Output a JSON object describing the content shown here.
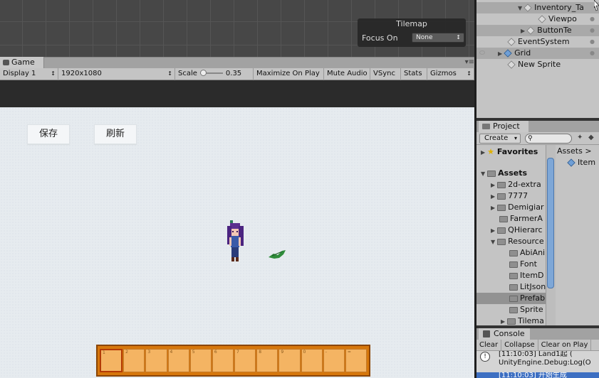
{
  "tilemap": {
    "title": "Tilemap",
    "focus_label": "Focus On",
    "focus_value": "None"
  },
  "game": {
    "tab_label": "Game",
    "menu_glyph": "▾≡",
    "display": "Display 1",
    "resolution": "1920x1080",
    "scale_label": "Scale",
    "scale_value": "0.35",
    "maximize": "Maximize On Play",
    "mute": "Mute Audio",
    "vsync": "VSync",
    "stats": "Stats",
    "gizmos": "Gizmos"
  },
  "ui": {
    "save_button": "保存",
    "refresh_button": "刷新"
  },
  "hotbar": {
    "slots": [
      "1",
      "2",
      "3",
      "4",
      "5",
      "6",
      "7",
      "8",
      "9",
      "0",
      "-",
      "="
    ],
    "selected_index": 0
  },
  "hierarchy": {
    "items": [
      "Inventory_Ta",
      "Viewpo",
      "ButtonTe",
      "EventSystem",
      "Grid",
      "New Sprite"
    ]
  },
  "project": {
    "tab_label": "Project",
    "create_label": "Create",
    "favorites": "Favorites",
    "assets": "Assets",
    "folders": [
      "2d-extra",
      "7777",
      "Demigiar",
      "FarmerA",
      "QHierarc",
      "Resource",
      "AbiAni",
      "Font",
      "ItemD",
      "LitJson",
      "Prefab",
      "Sprite",
      "Tilema"
    ],
    "breadcrumb": "Assets",
    "breadcrumb_sep": ">",
    "right_item": "Item"
  },
  "console": {
    "tab_label": "Console",
    "clear": "Clear",
    "collapse": "Collapse",
    "clear_on_play": "Clear on Play",
    "log1_line1": "[11:10:03] Land1起 (",
    "log1_line2": "UnityEngine.Debug:Log(O",
    "log2_line1": "[11:10:03] 开始生成"
  }
}
